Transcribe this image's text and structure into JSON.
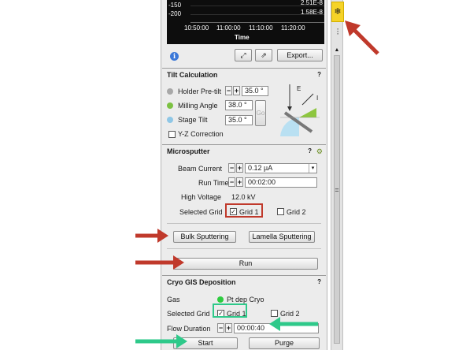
{
  "plot": {
    "y_ticks": [
      "-150",
      "-200"
    ],
    "right_values": [
      "2.51E-8",
      "1.58E-8"
    ],
    "x_ticks": [
      "10:50:00",
      "11:00:00",
      "11:10:00",
      "11:20:00"
    ],
    "x_label": "Time"
  },
  "plot_tools": {
    "export_label": "Export..."
  },
  "tilt": {
    "title": "Tilt Calculation",
    "help": "?",
    "holder_label": "Holder Pre-tilt",
    "holder_value": "35.0 °",
    "milling_label": "Milling Angle",
    "milling_value": "38.0 °",
    "stage_label": "Stage Tilt",
    "stage_value": "35.0 °",
    "go_label": "Go",
    "yz_label": "Y-Z Correction",
    "diagram_e": "E",
    "diagram_i": "I"
  },
  "microsputter": {
    "title": "Microsputter",
    "help": "?",
    "beam_label": "Beam Current",
    "beam_value": "0.12 µA",
    "runtime_label": "Run Time",
    "runtime_value": "00:02:00",
    "hv_label": "High Voltage",
    "hv_value": "12.0 kV",
    "grid_label": "Selected Grid",
    "grid1": "Grid 1",
    "grid2": "Grid 2",
    "bulk_label": "Bulk Sputtering",
    "lamella_label": "Lamella Sputtering",
    "run_label": "Run"
  },
  "gis": {
    "title": "Cryo GIS Deposition",
    "help": "?",
    "gas_label": "Gas",
    "gas_value": "Pt dep Cryo",
    "grid_label": "Selected Grid",
    "grid1": "Grid 1",
    "grid2": "Grid 2",
    "flow_label": "Flow Duration",
    "flow_value": "00:00:40",
    "start_label": "Start",
    "purge_label": "Purge"
  },
  "colors": {
    "accent_red": "#c0392b",
    "accent_green": "#2ec98a",
    "highlight_yellow": "#f5d328"
  }
}
